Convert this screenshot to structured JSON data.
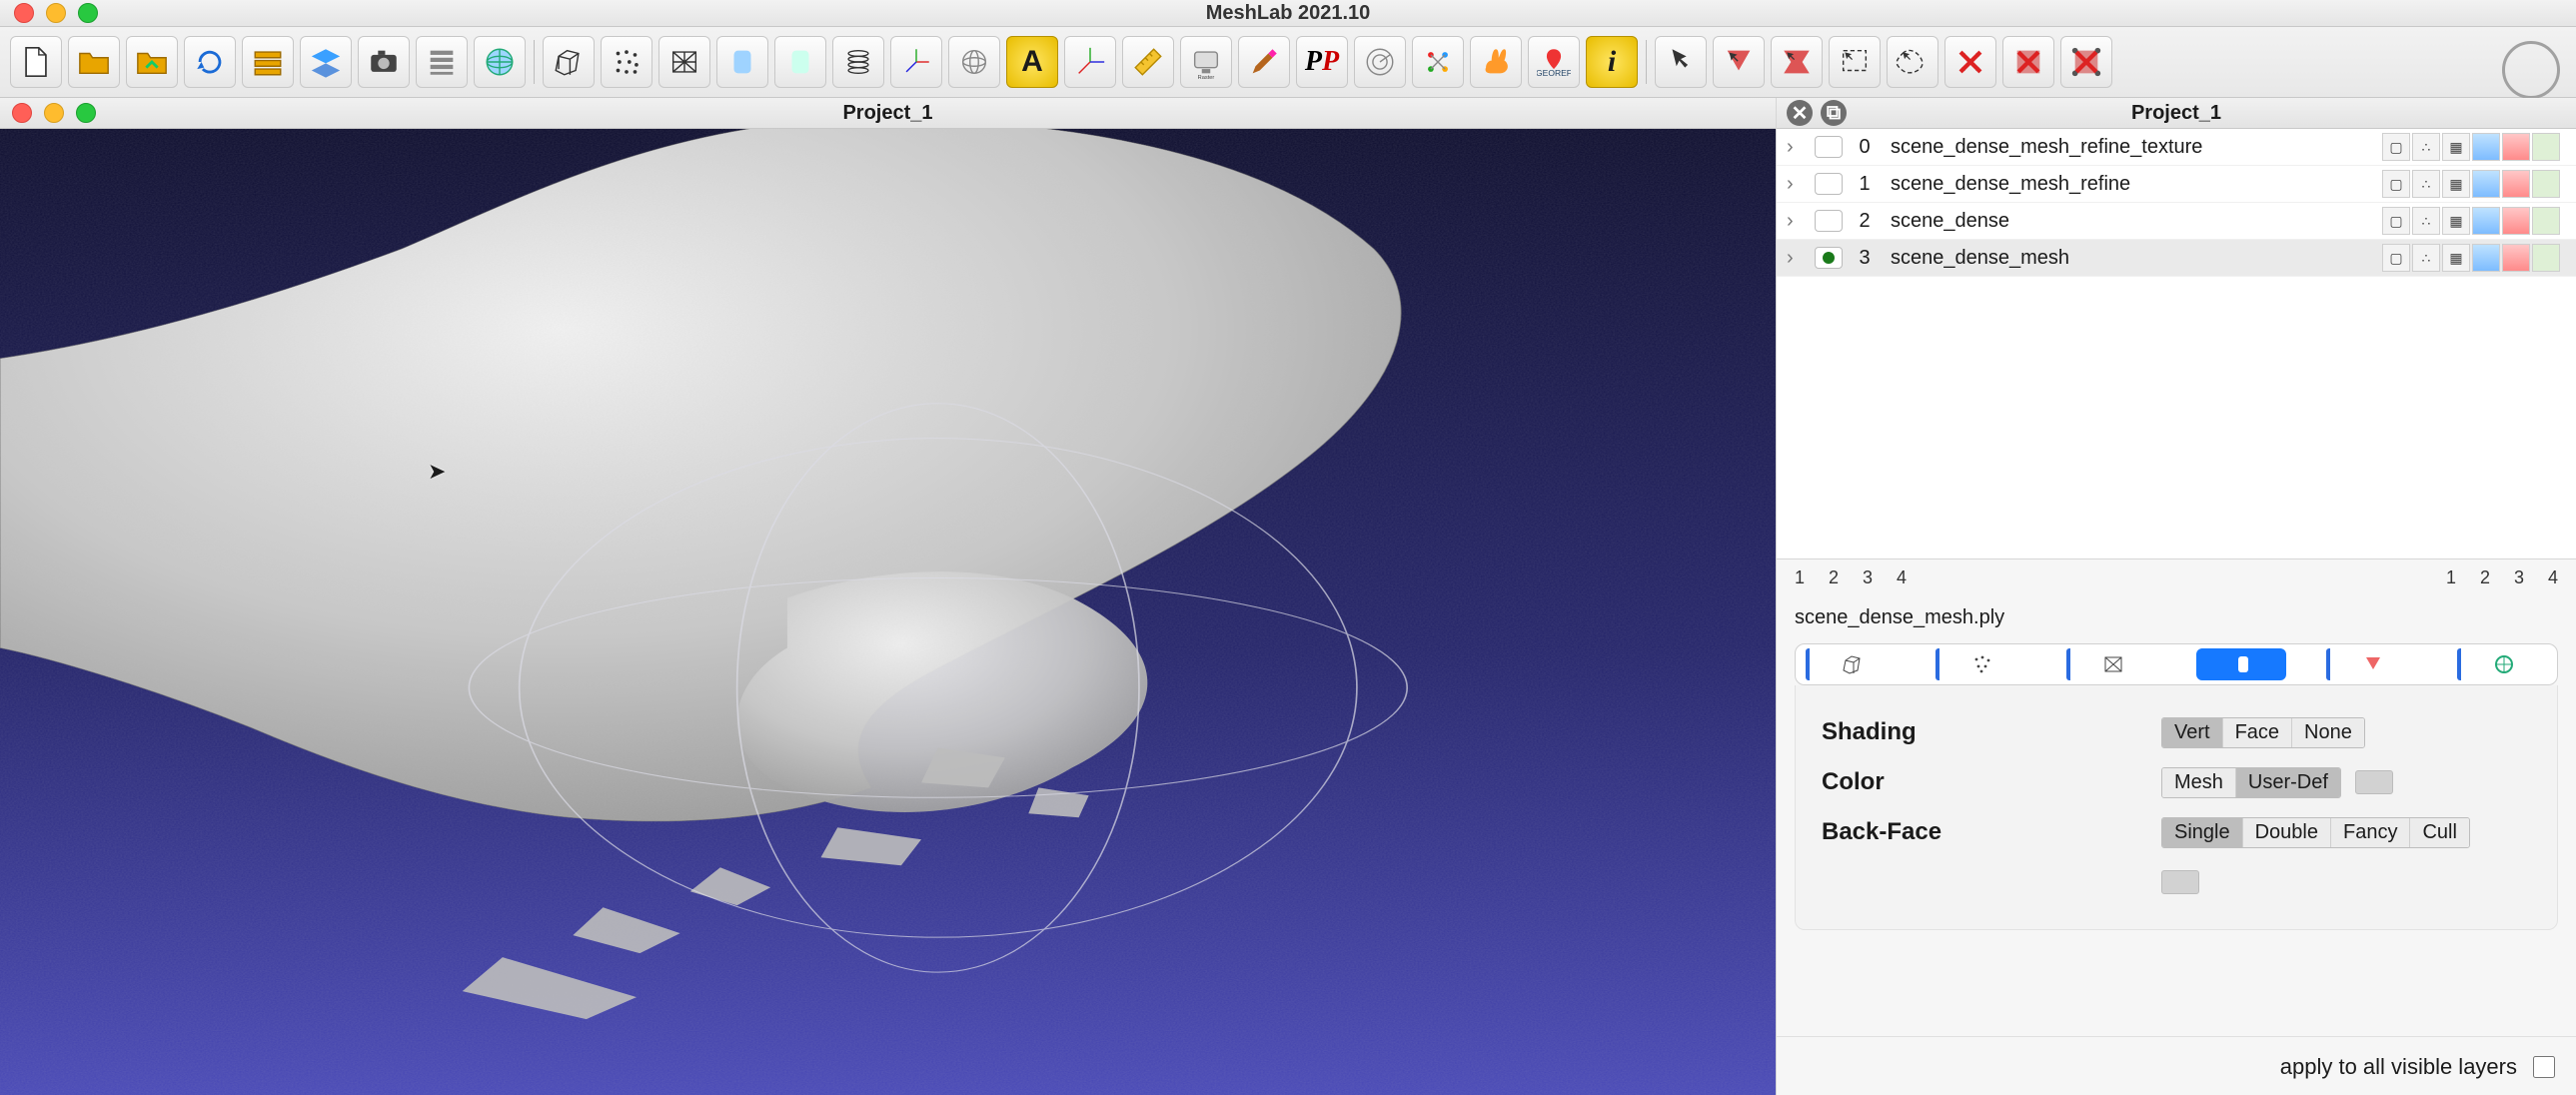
{
  "app": {
    "title": "MeshLab 2021.10"
  },
  "project": {
    "title": "Project_1"
  },
  "layer_panel": {
    "title": "Project_1",
    "layers": [
      {
        "index": "0",
        "name": "scene_dense_mesh_refine_texture",
        "visible": false,
        "selected": false
      },
      {
        "index": "1",
        "name": "scene_dense_mesh_refine",
        "visible": false,
        "selected": false
      },
      {
        "index": "2",
        "name": "scene_dense",
        "visible": false,
        "selected": false
      },
      {
        "index": "3",
        "name": "scene_dense_mesh",
        "visible": true,
        "selected": true
      }
    ],
    "pager_left": [
      "1",
      "2",
      "3",
      "4"
    ],
    "pager_right": [
      "1",
      "2",
      "3",
      "4"
    ],
    "current_file": "scene_dense_mesh.ply",
    "shading": {
      "label": "Shading",
      "options": [
        "Vert",
        "Face",
        "None"
      ],
      "selected": "Vert"
    },
    "color": {
      "label": "Color",
      "options": [
        "Mesh",
        "User-Def"
      ],
      "selected": "User-Def"
    },
    "backface": {
      "label": "Back-Face",
      "options": [
        "Single",
        "Double",
        "Fancy",
        "Cull"
      ],
      "selected": "Single"
    },
    "apply_label": "apply to all visible layers"
  },
  "toolbar": {
    "groups": [
      [
        "new-doc",
        "open-folder",
        "open-folder-alt",
        "reload",
        "layers-stack",
        "layer-toggle",
        "snapshot",
        "layer-sheets",
        "globe-grid"
      ],
      [
        "bbox",
        "points",
        "wireframe",
        "solid",
        "solid-flat",
        "stack-model",
        "axes",
        "gimbal",
        "label-A",
        "trackball",
        "measure",
        "raster-align",
        "paint",
        "pp-logo",
        "radar",
        "magnet-points",
        "bunny",
        "georef",
        "info"
      ],
      [
        "select-none",
        "select-faces",
        "select-faces-connected",
        "select-rect",
        "select-free",
        "delete-verts",
        "delete-faces",
        "delete-faces-verts"
      ]
    ]
  }
}
